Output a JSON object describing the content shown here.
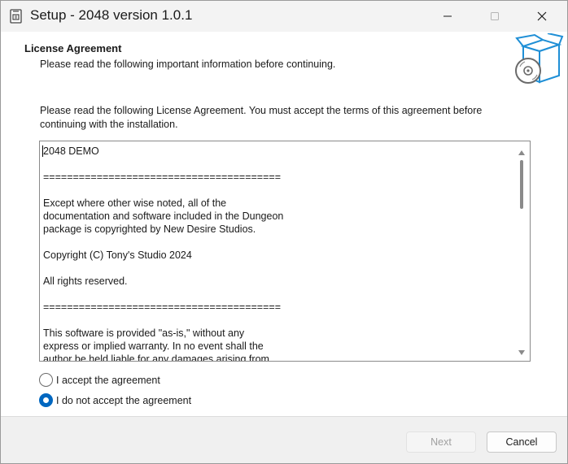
{
  "window": {
    "title": "Setup - 2048 version 1.0.1"
  },
  "header": {
    "title": "License Agreement",
    "subtitle": "Please read the following important information before continuing.",
    "icon": "setup-box-icon"
  },
  "instructions": {
    "line1": "Please read the following License Agreement. You must accept the terms of this agreement before",
    "line2": "continuing with the installation."
  },
  "license": {
    "lines": [
      "2048 DEMO",
      "",
      "========================================",
      "",
      "Except where other wise noted, all of the",
      "documentation and software included in the Dungeon",
      "package is copyrighted by New Desire Studios.",
      "",
      "Copyright (C) Tony's Studio 2024",
      "",
      "All rights reserved.",
      "",
      "========================================",
      "",
      "This software is provided \"as-is,\" without any",
      "express or implied warranty. In no event shall the",
      "author be held liable for any damages arising from"
    ]
  },
  "options": {
    "accept_label": "I accept the agreement",
    "decline_label": "I do not accept the agreement",
    "selected": "decline"
  },
  "footer": {
    "next_label": "Next",
    "cancel_label": "Cancel"
  },
  "colors": {
    "accent": "#0067c0",
    "titlebar": "#f3f3f3",
    "footer": "#f0f0f0"
  }
}
